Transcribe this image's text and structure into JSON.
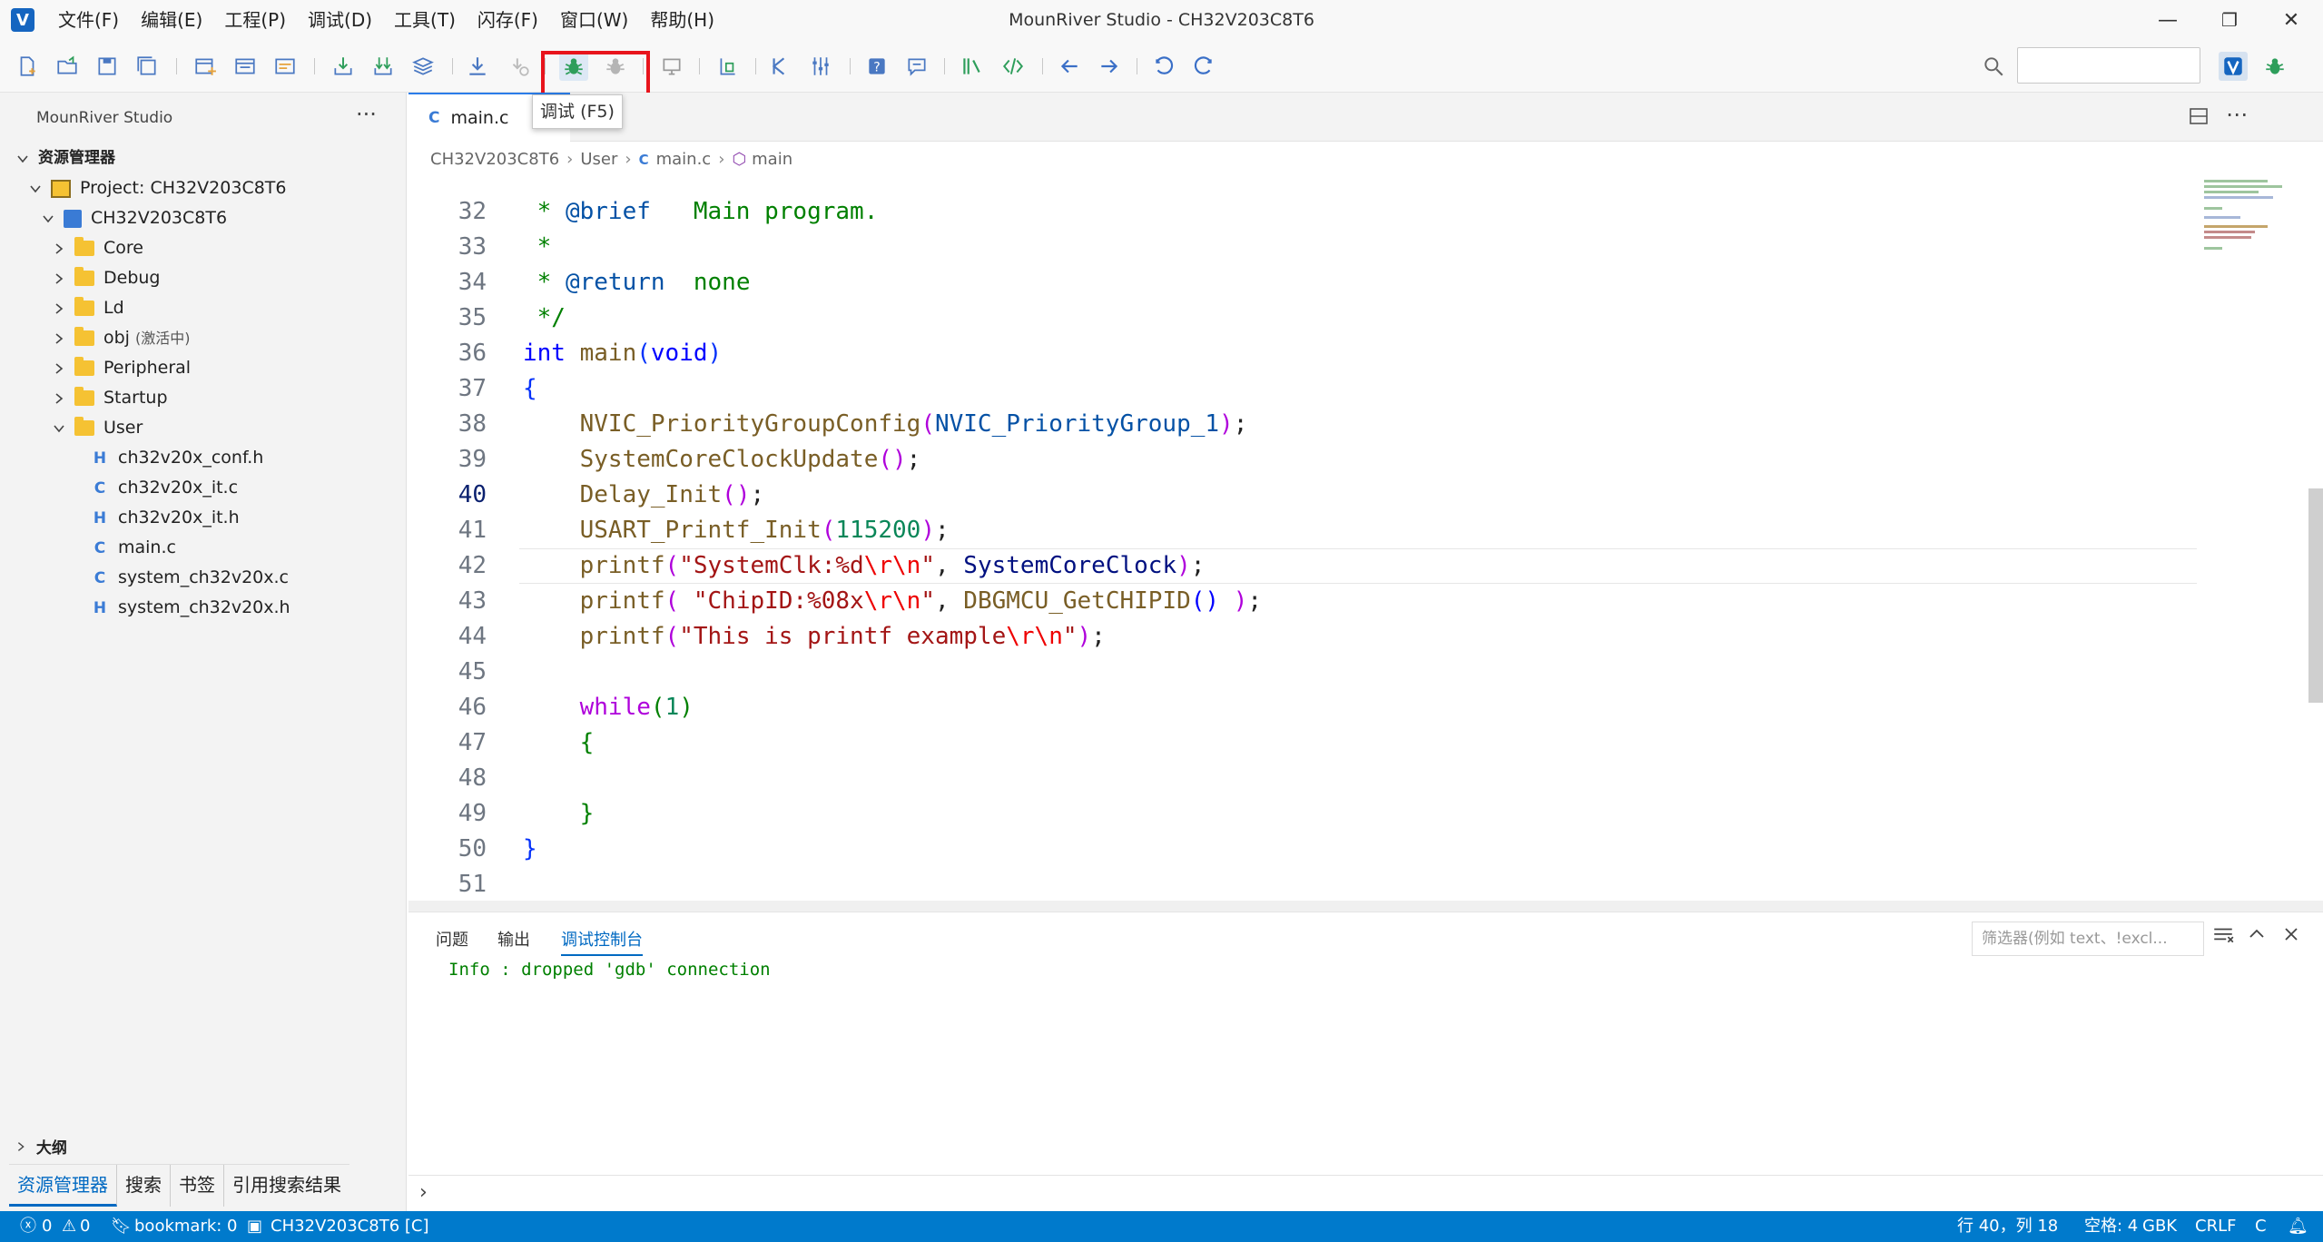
{
  "window": {
    "title": "MounRiver Studio - CH32V203C8T6"
  },
  "app": {
    "logo_letter": "V"
  },
  "menu": [
    "文件(F)",
    "编辑(E)",
    "工程(P)",
    "调试(D)",
    "工具(T)",
    "闪存(F)",
    "窗口(W)",
    "帮助(H)"
  ],
  "window_controls": {
    "minimize": "—",
    "restore": "❐",
    "close": "✕"
  },
  "tooltip": {
    "text": "调试 (F5)"
  },
  "sidebar": {
    "header": "MounRiver Studio",
    "more": "···",
    "explorer_title": "资源管理器",
    "project": "Project: CH32V203C8T6",
    "root": "CH32V203C8T6",
    "folders": [
      "Core",
      "Debug",
      "Ld",
      "obj",
      "Peripheral",
      "Startup",
      "User"
    ],
    "obj_suffix": "(激活中)",
    "files": [
      {
        "icon": "H",
        "name": "ch32v20x_conf.h"
      },
      {
        "icon": "C",
        "name": "ch32v20x_it.c"
      },
      {
        "icon": "H",
        "name": "ch32v20x_it.h"
      },
      {
        "icon": "C",
        "name": "main.c"
      },
      {
        "icon": "C",
        "name": "system_ch32v20x.c"
      },
      {
        "icon": "H",
        "name": "system_ch32v20x.h"
      }
    ],
    "outline": "大纲",
    "tabs": [
      "资源管理器",
      "搜索",
      "书签",
      "引用搜索结果"
    ]
  },
  "editor": {
    "tab_label": "main.c",
    "tab_icon": "C",
    "breadcrumb": [
      "CH32V203C8T6",
      "User",
      "main.c",
      "main"
    ],
    "current_line": "40",
    "line_numbers": [
      "32",
      "33",
      "34",
      "35",
      "36",
      "37",
      "38",
      "39",
      "40",
      "41",
      "42",
      "43",
      "44",
      "45",
      "46",
      "47",
      "48",
      "49",
      "50",
      "51"
    ]
  },
  "panel": {
    "tabs": [
      "问题",
      "输出",
      "调试控制台"
    ],
    "filter_placeholder": "筛选器(例如 text、!excl...",
    "console": "Info : dropped 'gdb' connection"
  },
  "statusbar": {
    "errors": "0",
    "warnings": "0",
    "bookmark": "bookmark: 0",
    "project": "CH32V203C8T6 [C]",
    "position": "行 40，列 18",
    "spaces": "空格: 4",
    "encoding": "GBK",
    "eol": "CRLF",
    "language": "C"
  },
  "colors": {
    "accent": "#007acc",
    "highlight": "#e8141c",
    "keyword": "#0000ff",
    "string": "#a31515",
    "comment": "#008000"
  }
}
